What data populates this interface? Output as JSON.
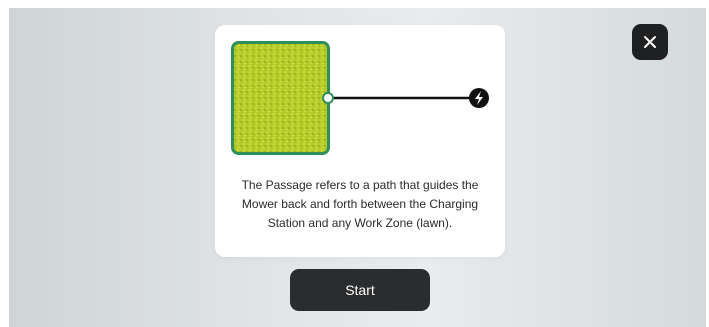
{
  "dialog": {
    "description": "The Passage refers to a path that guides the Mower back and forth between the Charging Station and any Work Zone (lawn).",
    "illustration": {
      "work_zone_icon": "lawn-work-zone",
      "passage_icon": "passage-line",
      "station_icon": "charging-station-bolt-icon"
    }
  },
  "actions": {
    "start_label": "Start",
    "close_icon": "close-icon"
  },
  "colors": {
    "backdrop": "#e2e6e8",
    "lawn_fill": "#b5cc2a",
    "lawn_border": "#2f8f5b",
    "button_bg": "#2b2c2e",
    "station": "#111111"
  }
}
